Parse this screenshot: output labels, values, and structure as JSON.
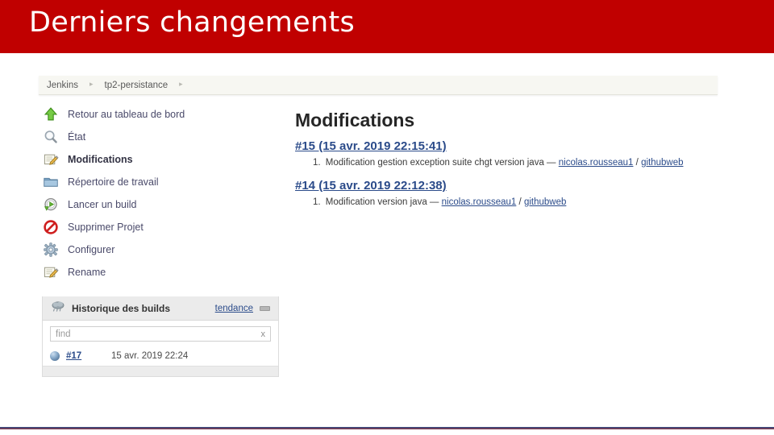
{
  "slide": {
    "title": "Derniers changements",
    "banner_color": "#c00000"
  },
  "breadcrumb": {
    "items": [
      "Jenkins",
      "tp2-persistance"
    ],
    "separator": "▸"
  },
  "sidebar": {
    "items": [
      {
        "label": "Retour au tableau de bord",
        "icon": "up-arrow-icon",
        "active": false
      },
      {
        "label": "État",
        "icon": "magnifier-icon",
        "active": false
      },
      {
        "label": "Modifications",
        "icon": "edit-pencil-icon",
        "active": true
      },
      {
        "label": "Répertoire de travail",
        "icon": "folder-icon",
        "active": false
      },
      {
        "label": "Lancer un build",
        "icon": "play-clock-icon",
        "active": false
      },
      {
        "label": "Supprimer Projet",
        "icon": "no-entry-icon",
        "active": false
      },
      {
        "label": "Configurer",
        "icon": "gear-icon",
        "active": false
      },
      {
        "label": "Rename",
        "icon": "edit-pencil-icon",
        "active": false
      }
    ]
  },
  "build_history": {
    "icon": "weather-cloud-icon",
    "title": "Historique des builds",
    "trend_label": "tendance",
    "trend_icon": "dash-icon",
    "find_placeholder": "find",
    "clear_label": "x",
    "builds": [
      {
        "number": "#17",
        "date": "15 avr. 2019 22:24",
        "status": "pending",
        "status_color": "#5d7fa3"
      }
    ]
  },
  "main": {
    "heading": "Modifications",
    "changesets": [
      {
        "build_link": "#15 (15 avr. 2019 22:15:41)",
        "entries": [
          {
            "index": "1.",
            "message": "Modification gestion exception suite chgt version java",
            "dash": "—",
            "author": "nicolas.rousseau1",
            "slash": "/",
            "repo_link": "githubweb"
          }
        ]
      },
      {
        "build_link": "#14 (15 avr. 2019 22:12:38)",
        "entries": [
          {
            "index": "1.",
            "message": "Modification version java",
            "dash": "—",
            "author": "nicolas.rousseau1",
            "slash": "/",
            "repo_link": "githubweb"
          }
        ]
      }
    ]
  }
}
